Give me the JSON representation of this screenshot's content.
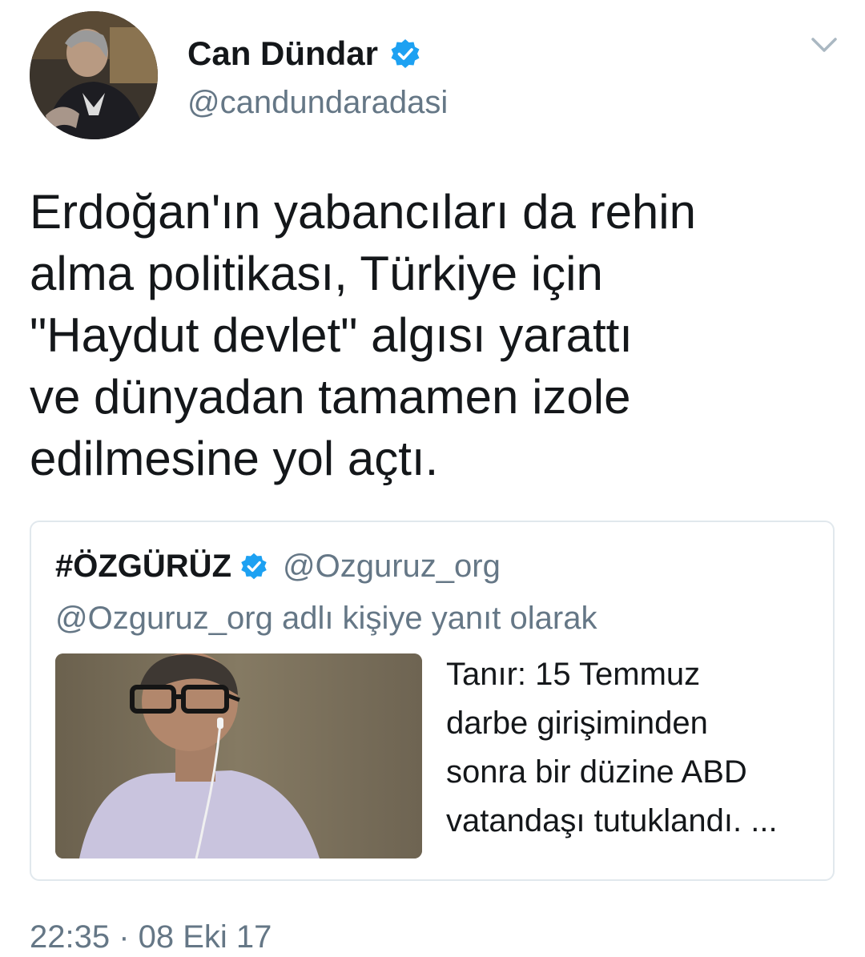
{
  "tweet": {
    "author": {
      "display_name": "Can Dündar",
      "handle": "@candundaradasi",
      "verified": true,
      "avatar_icon": "profile-photo"
    },
    "menu_icon": "chevron-down-icon",
    "text_lines": [
      "Erdoğan'ın yabancıları da rehin",
      "alma politikası, Türkiye için",
      "\"Haydut devlet\" algısı yarattı",
      "ve dünyadan tamamen izole",
      "edilmesine yol açtı."
    ],
    "timestamp": "22:35 · 08 Eki 17"
  },
  "quoted_tweet": {
    "author_name": "#ÖZGÜRÜZ",
    "verified": true,
    "handle": "@Ozguruz_org",
    "reply_context": "@Ozguruz_org adlı kişiye yanıt olarak",
    "media_icon": "video-thumbnail",
    "text_lines": [
      "Tanır: 15 Temmuz",
      "darbe girişiminden",
      "sonra bir düzine ABD",
      "vatandaşı tutuklandı. ..."
    ]
  },
  "colors": {
    "verified_blue": "#1da1f2",
    "secondary_text": "#657786",
    "primary_text": "#14171a",
    "border": "#e1e8ed"
  }
}
